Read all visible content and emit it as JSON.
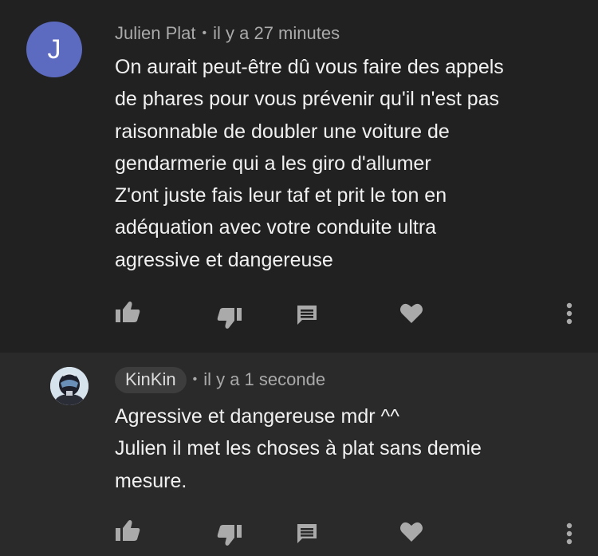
{
  "comments": [
    {
      "author": "Julien Plat",
      "avatar_letter": "J",
      "separator": "•",
      "time": "il y a 27 minutes",
      "lines": [
        "On aurait peut-être dû vous faire des appels",
        "de phares pour vous prévenir qu'il n'est pas",
        "raisonnable de doubler une voiture de",
        "gendarmerie qui a les giro d'allumer",
        "Z'ont juste fais leur taf et prit le ton en",
        "adéquation avec votre conduite ultra",
        "agressive et dangereuse"
      ],
      "avatar_color": "#5c6bc0"
    },
    {
      "author": "KinKin",
      "separator": "•",
      "time": "il y a 1 seconde",
      "lines": [
        "Agressive et dangereuse mdr ^^",
        "Julien il met les choses à plat sans demie",
        "mesure."
      ]
    }
  ],
  "actions": [
    "thumb-up-icon",
    "thumb-down-icon",
    "reply-icon",
    "heart-icon",
    "more-vert-icon"
  ],
  "colors": {
    "background": "#212121",
    "reply_background": "#2a2a2a",
    "icon": "#aaaaaa",
    "text": "#f1f1f1",
    "meta": "#aaaaaa"
  }
}
